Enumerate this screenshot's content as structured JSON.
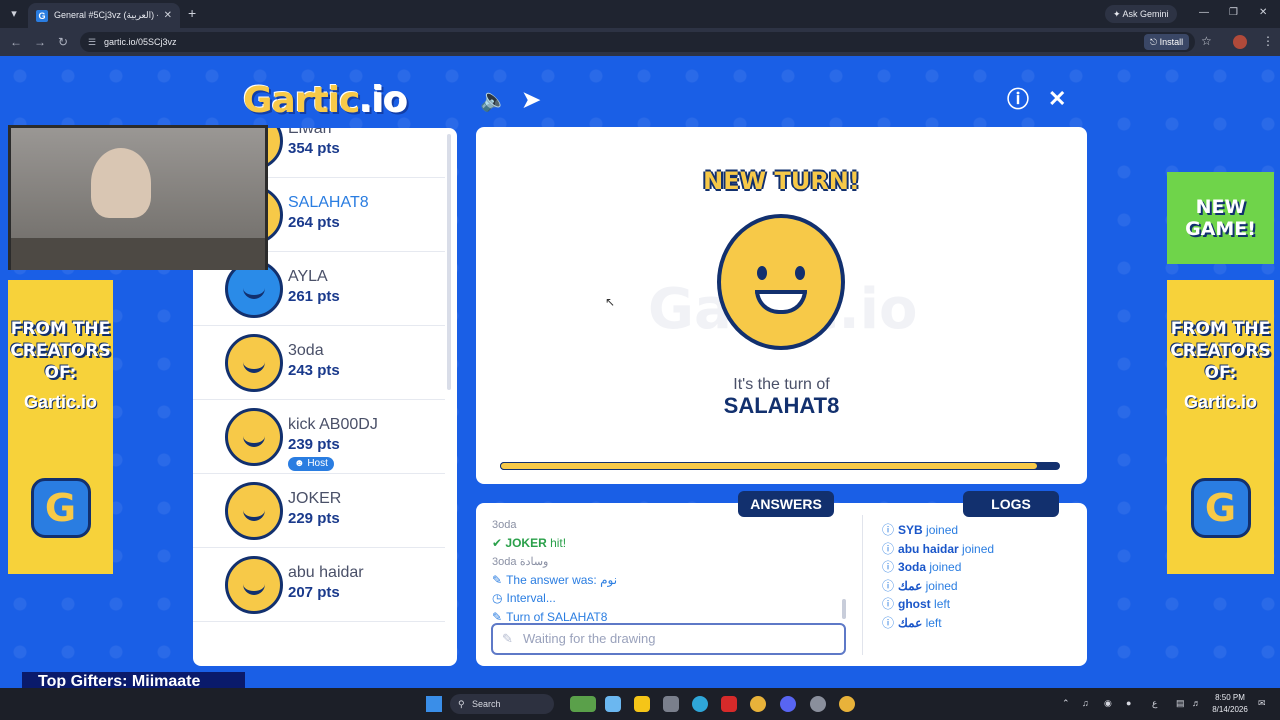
{
  "browser": {
    "tab_title": "General #5Cj3vz (العربية) - Gartic",
    "tab_favicon": "G",
    "url": "gartic.io/05SCj3vz",
    "ask_gemini": "Ask Gemini",
    "install": "Install"
  },
  "game": {
    "logo_main": "Gartic",
    "logo_io": ".io",
    "new_turn": "NEW TURN!",
    "turn_of_label": "It's the turn of",
    "turn_player": "SALAHAT8",
    "watermark": "Gartic.io",
    "progress_fraction": 0.96,
    "colors": {
      "brand_blue": "#1a5fe6",
      "navy": "#12306e",
      "yellow": "#f7c948",
      "accent": "#2a7de1"
    }
  },
  "players": [
    {
      "name": "Elwan",
      "pts": "354 pts",
      "active": false,
      "avatar": "smiley",
      "host": false
    },
    {
      "name": "SALAHAT8",
      "pts": "264 pts",
      "active": true,
      "avatar": "smiley",
      "host": false
    },
    {
      "name": "AYLA",
      "pts": "261 pts",
      "active": false,
      "avatar": "girl",
      "host": false
    },
    {
      "name": "3oda",
      "pts": "243 pts",
      "active": false,
      "avatar": "smiley",
      "host": false
    },
    {
      "name": "kick AB00DJ",
      "pts": "239 pts",
      "active": false,
      "avatar": "smiley",
      "host": true
    },
    {
      "name": "JOKER",
      "pts": "229 pts",
      "active": false,
      "avatar": "smiley",
      "host": false
    },
    {
      "name": "abu haidar",
      "pts": "207 pts",
      "active": false,
      "avatar": "smiley",
      "host": false
    }
  ],
  "host_label": "Host",
  "answers_panel": {
    "title": "ANSWERS",
    "lines": [
      {
        "who": "3oda",
        "text": "",
        "kind": "faded"
      },
      {
        "who": "JOKER",
        "text": "hit!",
        "kind": "hit"
      },
      {
        "who": "3oda",
        "text": "وسادة",
        "kind": "guess"
      },
      {
        "who": "",
        "text": "The answer was: نوم",
        "kind": "info"
      },
      {
        "who": "",
        "text": "Interval...",
        "kind": "clock"
      },
      {
        "who": "",
        "text": "Turn of SALAHAT8",
        "kind": "info"
      }
    ],
    "input_placeholder": "Waiting for the drawing"
  },
  "logs_panel": {
    "title": "LOGS",
    "lines": [
      {
        "name": "SYB",
        "action": "joined"
      },
      {
        "name": "abu haidar",
        "action": "joined"
      },
      {
        "name": "3oda",
        "action": "joined"
      },
      {
        "name": "عمك",
        "action": "joined"
      },
      {
        "name": "ghost",
        "action": "left"
      },
      {
        "name": "عمك",
        "action": "left"
      }
    ]
  },
  "banners": {
    "left_text": "FROM THE CREATORS OF:",
    "left_brand": "Gartic.io",
    "right_text": "FROM THE CREATORS OF:",
    "right_brand": "Gartic.io",
    "new_game": "NEW GAME!",
    "g_logo": "G"
  },
  "overlay": {
    "gifters": "Top Gifters: Miimaate"
  },
  "taskbar": {
    "search": "Search",
    "time": "8:50 PM",
    "date": "8/14/2026",
    "lang": "ع"
  }
}
